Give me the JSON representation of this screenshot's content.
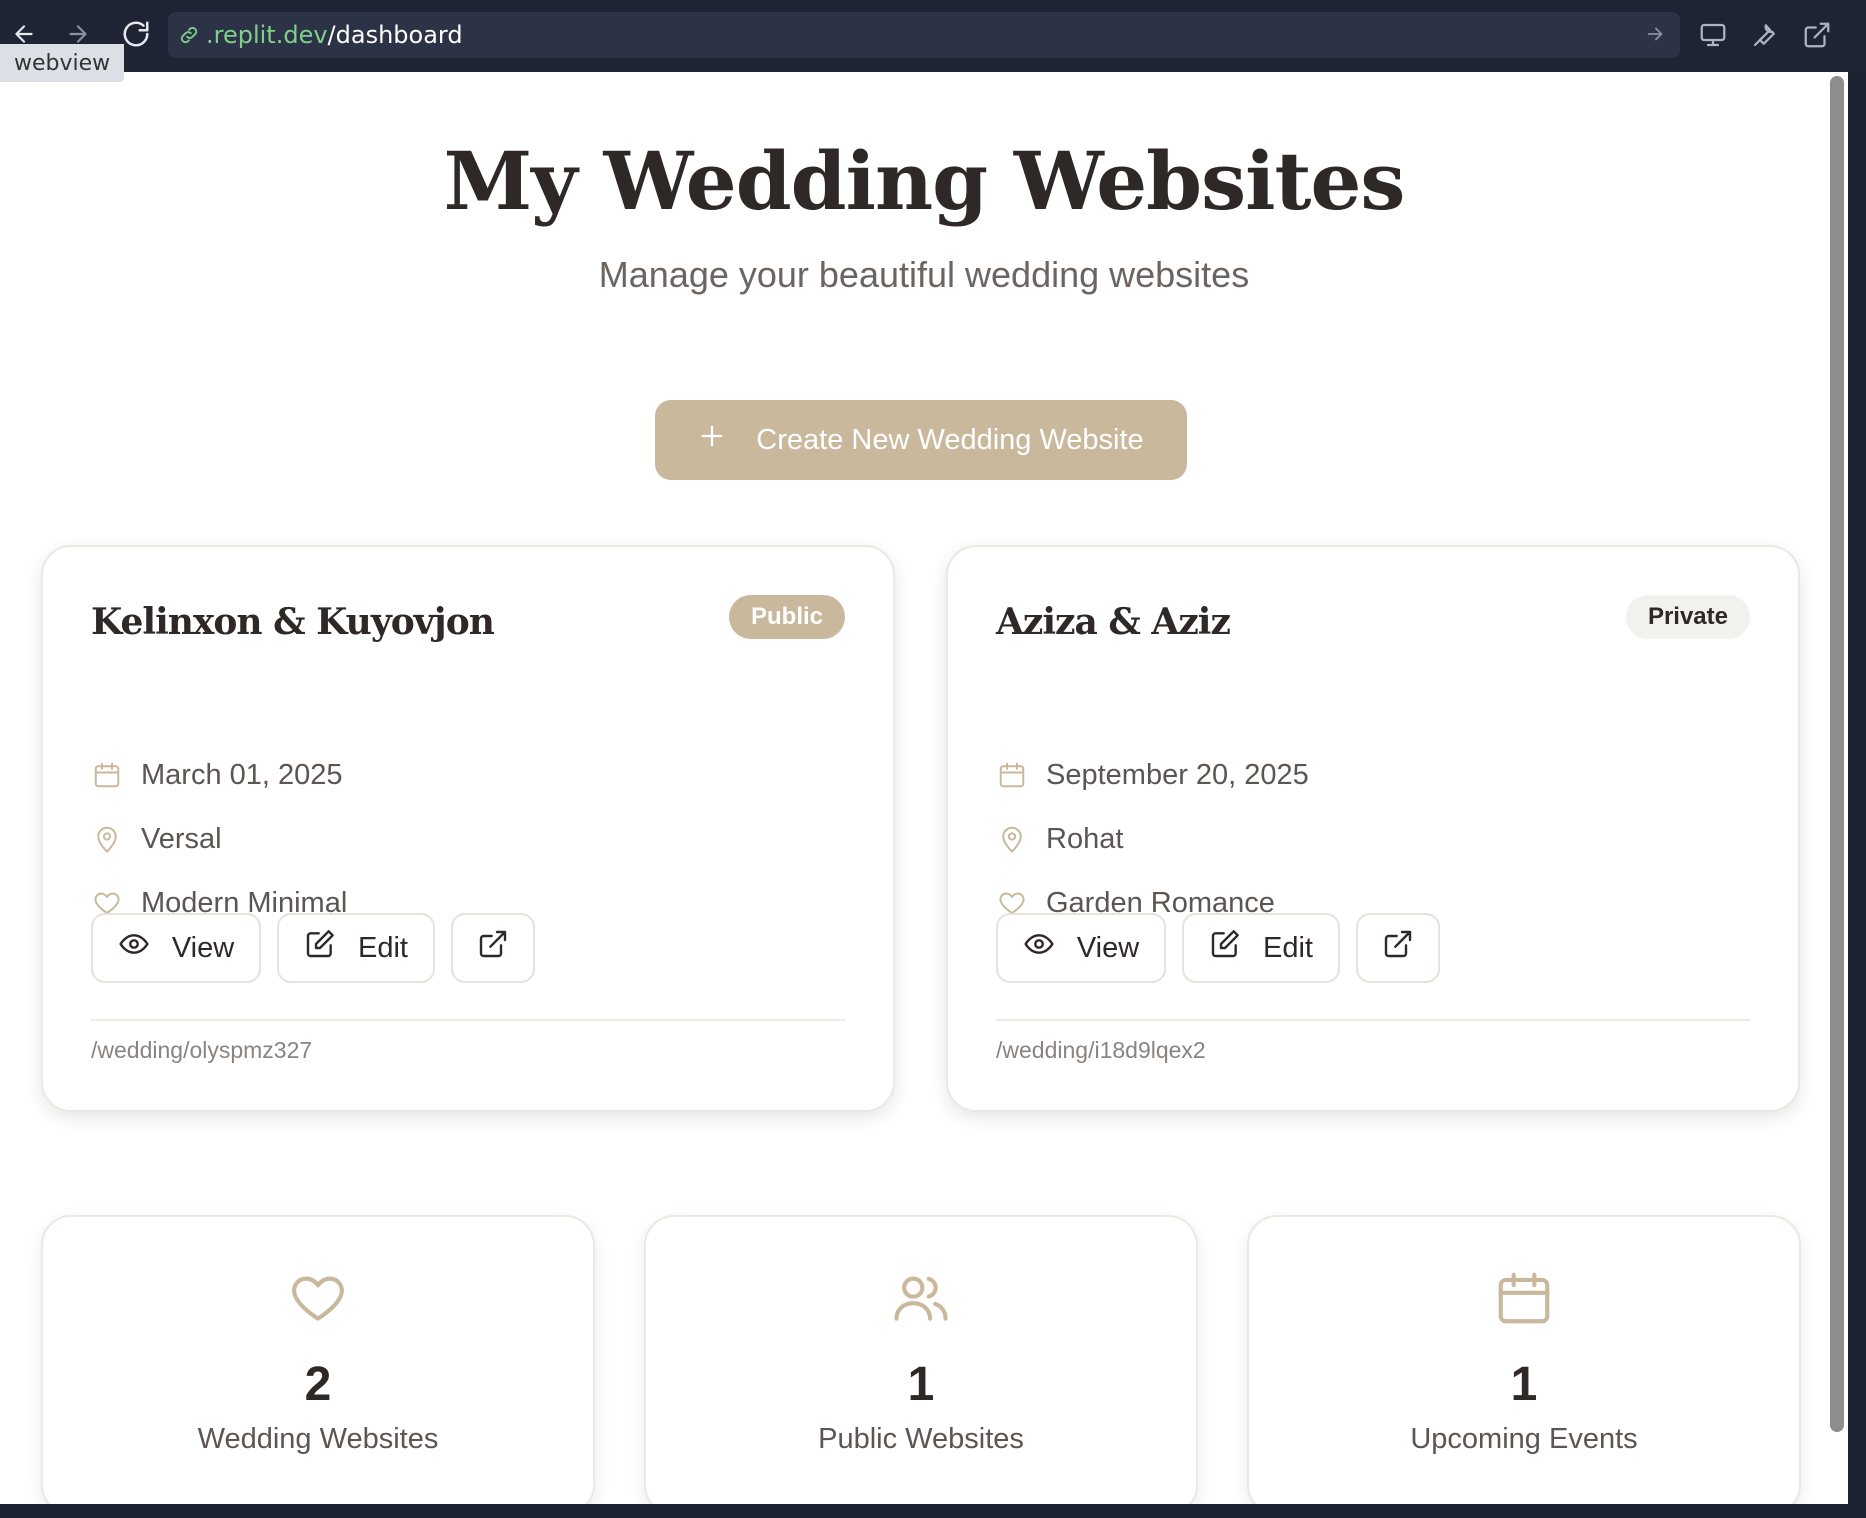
{
  "browser": {
    "url_domain": ".replit.dev",
    "url_path": "/dashboard",
    "webview_tag": "webview"
  },
  "header": {
    "title": "My Wedding Websites",
    "subtitle": "Manage your beautiful wedding websites"
  },
  "create_button": {
    "label": "Create New Wedding Website"
  },
  "websites": [
    {
      "title": "Kelinxon & Kuyovjon",
      "status": "Public",
      "date": "March 01, 2025",
      "location": "Versal",
      "theme": "Modern Minimal",
      "view_label": "View",
      "edit_label": "Edit",
      "url": "/wedding/olyspmz327"
    },
    {
      "title": "Aziza & Aziz",
      "status": "Private",
      "date": "September 20, 2025",
      "location": "Rohat",
      "theme": "Garden Romance",
      "view_label": "View",
      "edit_label": "Edit",
      "url": "/wedding/i18d9lqex2"
    }
  ],
  "stats": [
    {
      "icon": "heart-icon",
      "value": "2",
      "label": "Wedding Websites"
    },
    {
      "icon": "users-icon",
      "value": "1",
      "label": "Public Websites"
    },
    {
      "icon": "calendar-icon",
      "value": "1",
      "label": "Upcoming Events"
    }
  ],
  "colors": {
    "accent": "#c9b89c",
    "heading": "#2e2826",
    "browser_bar": "#1e2433"
  }
}
